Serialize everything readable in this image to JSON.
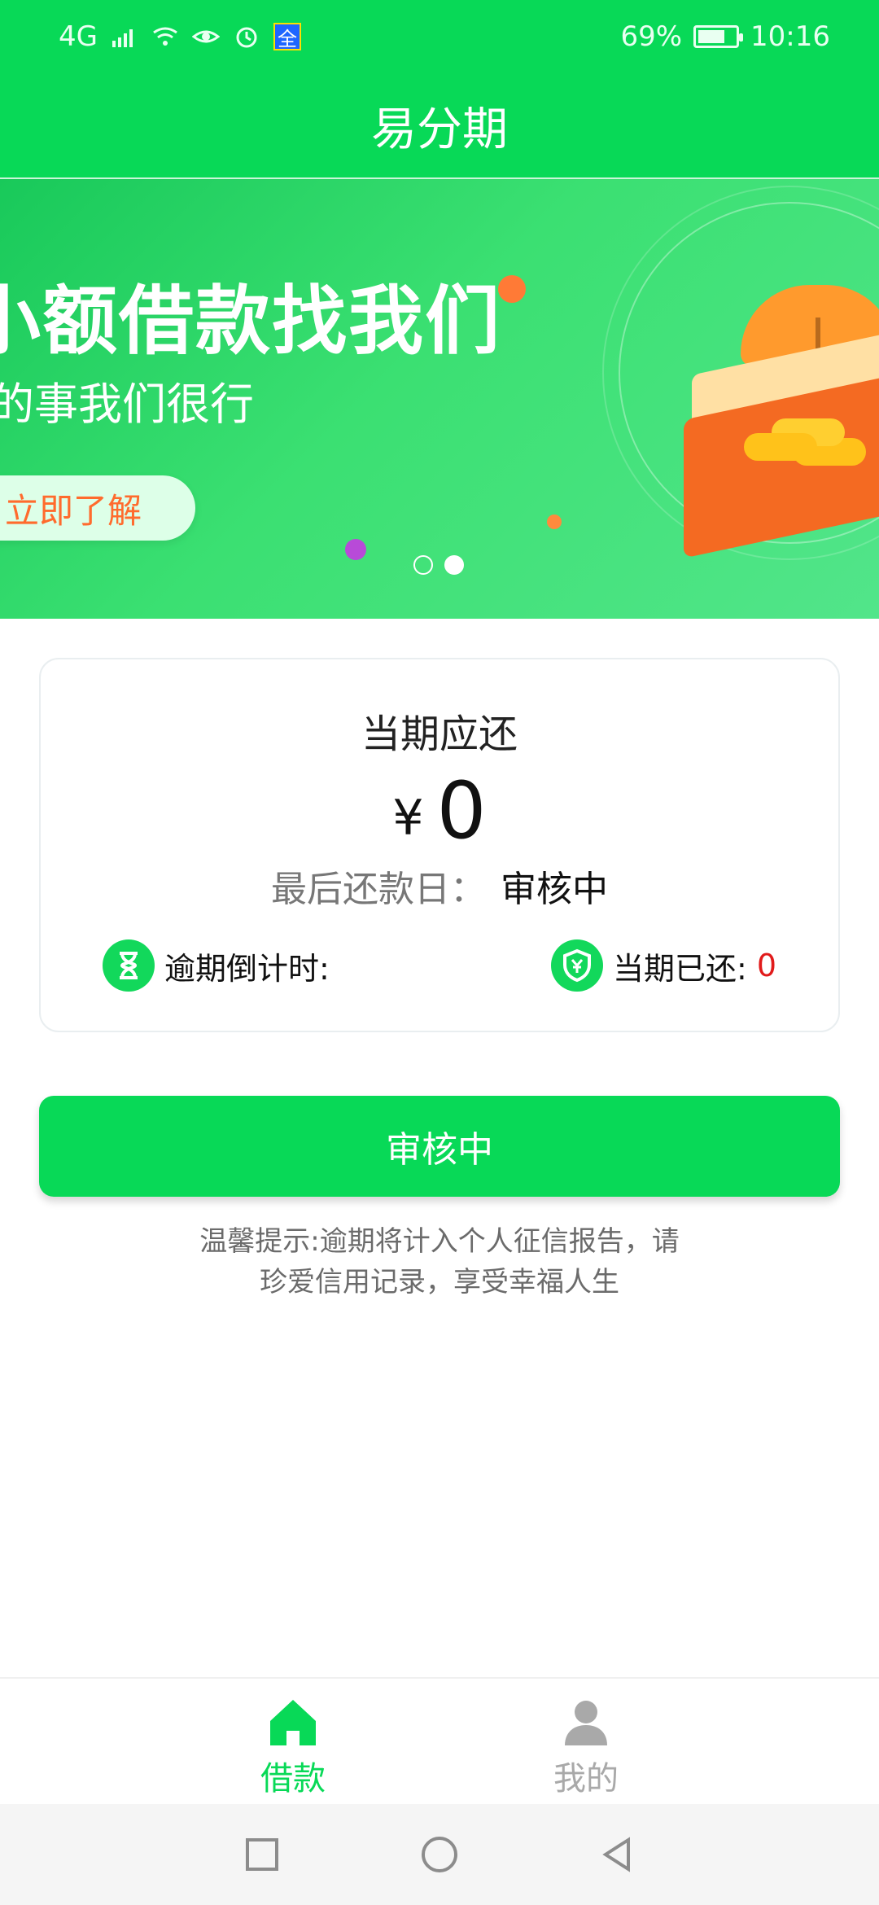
{
  "status": {
    "network": "4G",
    "battery_text": "69%",
    "time": "10:16",
    "app_badge": "全"
  },
  "header": {
    "title": "易分期"
  },
  "banner": {
    "headline": "小额借款找我们",
    "subline": "的事我们很行",
    "cta": "立即了解",
    "carousel": {
      "active_index": 1,
      "total": 2
    }
  },
  "repayment": {
    "title": "当期应还",
    "currency": "¥",
    "amount": "0",
    "due_label": "最后还款日：",
    "due_value": "审核中",
    "countdown_label": "逾期倒计时:",
    "paid_label": "当期已还:",
    "paid_value": "0"
  },
  "action": {
    "button_label": "审核中"
  },
  "tip": {
    "line1": "温馨提示:逾期将计入个人征信报告，请",
    "line2": "珍爱信用记录，享受幸福人生"
  },
  "nav": {
    "home_label": "借款",
    "me_label": "我的"
  },
  "colors": {
    "primary": "#08d957",
    "alert": "#e11b1b",
    "banner_cta": "#ff6b2d"
  },
  "icons": {
    "status": [
      "signal-icon",
      "wifi-icon",
      "eye-icon",
      "alarm-icon",
      "battery-icon"
    ],
    "card": [
      "hourglass-icon",
      "shield-yen-icon"
    ],
    "nav": [
      "home-icon",
      "profile-icon"
    ],
    "system": [
      "square-button-icon",
      "circle-button-icon",
      "back-triangle-icon"
    ]
  }
}
